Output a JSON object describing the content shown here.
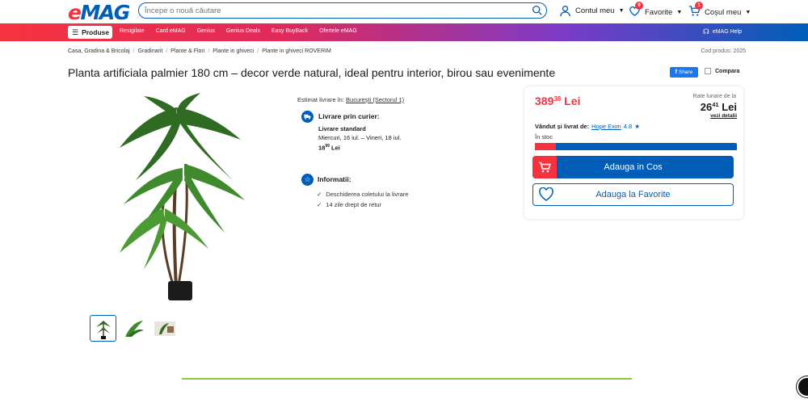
{
  "header": {
    "logo": "eMAG",
    "search_placeholder": "Începe o nouă căutare",
    "account_label": "Contul meu",
    "favorites_label": "Favorite",
    "favorites_count": "9",
    "cart_label": "Coșul meu",
    "cart_count": "1"
  },
  "nav": {
    "products_label": "Produse",
    "links": [
      "Resigilate",
      "Card eMAG",
      "Genius",
      "Genius Deals",
      "Easy BuyBack",
      "Ofertele eMAG"
    ],
    "help_label": "eMAG Help"
  },
  "breadcrumb": [
    "Casa, Gradina & Bricolaj",
    "Gradinarit",
    "Plante & Flori",
    "Plante in ghiveci",
    "Plante in ghiveci ROVERIM"
  ],
  "product_code": "Cod produs: 2025",
  "product": {
    "title": "Planta artificiala palmier 180 cm – decor verde natural, ideal pentru interior, birou sau evenimente",
    "share_label": "Share",
    "compare_label": "Compara"
  },
  "delivery": {
    "estimate_prefix": "Estimat livrare în:",
    "estimate_location": "București (Sectorul 1)",
    "courier_title": "Livrare prin curier:",
    "standard_label": "Livrare standard",
    "dates": "Miercuri, 16 iul. – Vineri, 18 iul.",
    "price_main": "18",
    "price_dec": "99",
    "price_currency": "Lei"
  },
  "info": {
    "title": "Informatii:",
    "items": [
      "Deschiderea coletului la livrare",
      "14 zile drept de retur"
    ]
  },
  "buybox": {
    "price_main": "389",
    "price_dec": "38",
    "currency": "Lei",
    "rate_label": "Rate lunare de la",
    "rate_main": "26",
    "rate_dec": "41",
    "rate_currency": "Lei",
    "rate_link": "vezi detalii",
    "seller_prefix": "Vândut și livrat de:",
    "seller_name": "Hope Exim",
    "seller_rating": "4.8",
    "stock": "În stoc",
    "add_to_cart": "Adauga in Cos",
    "add_to_favorites": "Adauga la Favorite"
  },
  "colors": {
    "brand_blue": "#005eb8",
    "brand_red": "#f5333f"
  }
}
